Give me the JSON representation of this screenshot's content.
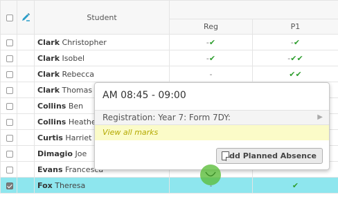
{
  "header": {
    "student_label": "Student",
    "reg_label": "Reg",
    "p1_label": "P1"
  },
  "rows": [
    {
      "surname": "Clark",
      "firstname": "Christopher",
      "reg": "-✔",
      "p1": "-✔",
      "checked": false
    },
    {
      "surname": "Clark",
      "firstname": "Isobel",
      "reg": "-✔",
      "p1": "-✔✔",
      "checked": false
    },
    {
      "surname": "Clark",
      "firstname": "Rebecca",
      "reg": "-",
      "p1": "✔✔",
      "checked": false
    },
    {
      "surname": "Clark",
      "firstname": "Thomas",
      "reg": "",
      "p1": "",
      "checked": false
    },
    {
      "surname": "Collins",
      "firstname": "Ben",
      "reg": "",
      "p1": "",
      "checked": false
    },
    {
      "surname": "Collins",
      "firstname": "Heather",
      "reg": "",
      "p1": "",
      "checked": false
    },
    {
      "surname": "Curtis",
      "firstname": "Harriet",
      "reg": "",
      "p1": "",
      "checked": false
    },
    {
      "surname": "Dimagio",
      "firstname": "Joe",
      "reg": "",
      "p1": "",
      "checked": false
    },
    {
      "surname": "Evans",
      "firstname": "Francesca",
      "reg": "",
      "p1": "",
      "checked": false
    },
    {
      "surname": "Fox",
      "firstname": "Theresa",
      "reg": "-",
      "p1": "✔",
      "checked": true
    }
  ],
  "popup": {
    "title": "AM 08:45 - 09:00",
    "registration": "Registration: Year 7: Form 7DY:",
    "view_all": "View all marks",
    "planned_absence": "Add Planned Absence"
  },
  "colors": {
    "tick": "#2e9e2e",
    "selected_row": "#8ee6ee",
    "view_all_bg": "#fbfbc8"
  }
}
